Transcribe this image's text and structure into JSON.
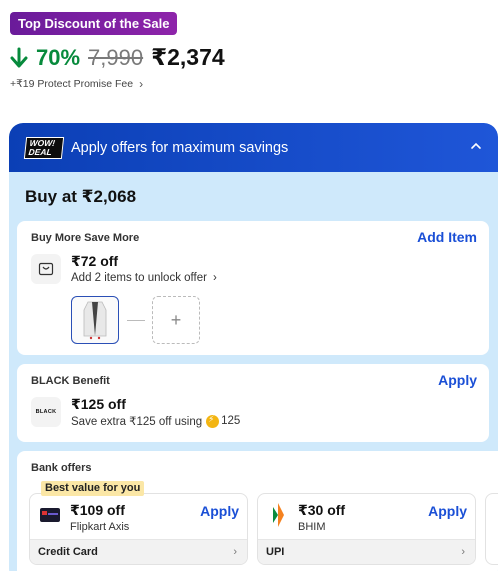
{
  "deal_badge": "Top Discount of the Sale",
  "pricing": {
    "discount": "70%",
    "mrp": "7,990",
    "price": "₹2,374",
    "fee_text": "+₹19 Protect Promise Fee"
  },
  "offers": {
    "wow_line1": "WOW!",
    "wow_line2": "DEAL",
    "header_title": "Apply offers for maximum savings",
    "buy_at": "Buy at ₹2,068",
    "buy_more": {
      "title": "Buy More Save More",
      "action": "Add Item",
      "amount": "₹72 off",
      "subtext": "Add 2 items to unlock offer"
    },
    "black": {
      "title": "BLACK Benefit",
      "action": "Apply",
      "logo_text": "BLACK",
      "amount": "₹125 off",
      "subtext": "Save extra ₹125 off using",
      "coins": "125"
    },
    "bank": {
      "title": "Bank offers",
      "ribbon": "Best value for you",
      "cards": [
        {
          "amount": "₹109 off",
          "name": "Flipkart Axis",
          "action": "Apply",
          "footer": "Credit Card"
        },
        {
          "amount": "₹30 off",
          "name": "BHIM",
          "action": "Apply",
          "footer": "UPI"
        }
      ]
    }
  },
  "colors": {
    "badge": "#7b1fa2",
    "discount": "#078a3c",
    "header": "#0b3fb5",
    "panel": "#cfe9fb",
    "action": "#1a4fd6",
    "ribbon": "#fbe7a6"
  }
}
